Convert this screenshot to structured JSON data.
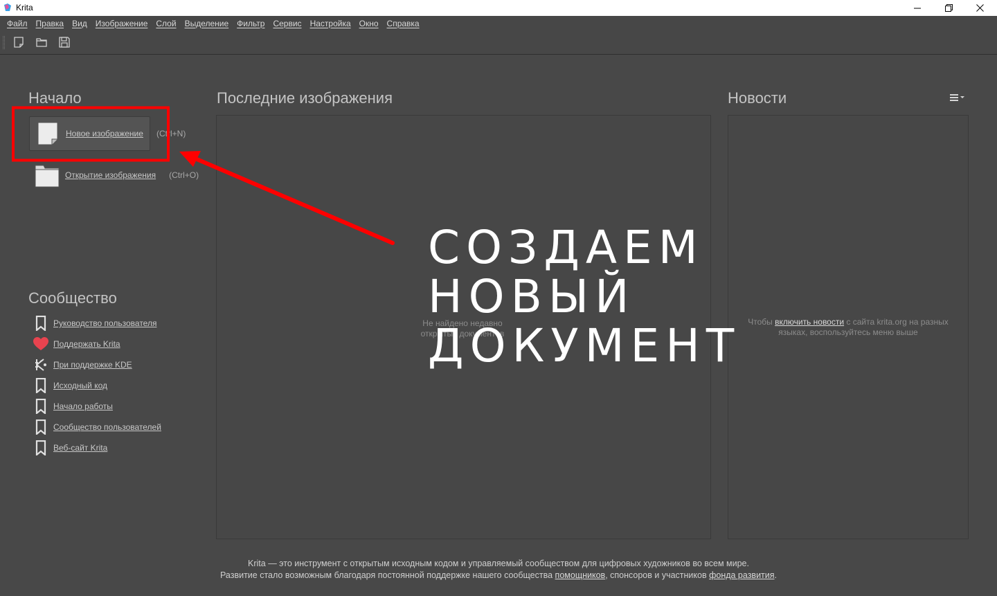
{
  "window": {
    "title": "Krita"
  },
  "menu": [
    "Файл",
    "Правка",
    "Вид",
    "Изображение",
    "Слой",
    "Выделение",
    "Фильтр",
    "Сервис",
    "Настройка",
    "Окно",
    "Справка"
  ],
  "start": {
    "heading": "Начало",
    "new_image": {
      "label": "Новое изображение",
      "shortcut": "(Ctrl+N)"
    },
    "open_image": {
      "label": "Открытие изображения",
      "shortcut": "(Ctrl+O)"
    }
  },
  "recent": {
    "heading": "Последние изображения",
    "empty_line1": "Не найдено недавно",
    "empty_line2": "открытых документов"
  },
  "news": {
    "heading": "Новости",
    "msg_before": "Чтобы ",
    "msg_link": "включить новости",
    "msg_after": " с сайта krita.org на разных",
    "msg_line2": "языках, воспользуйтесь меню выше"
  },
  "community": {
    "heading": "Сообщество",
    "items": [
      {
        "label": "Руководство пользователя",
        "icon": "bookmark-icon"
      },
      {
        "label": "Поддержать Krita",
        "icon": "heart-icon"
      },
      {
        "label": "При поддержке KDE",
        "icon": "kde-icon"
      },
      {
        "label": "Исходный код",
        "icon": "bookmark-icon"
      },
      {
        "label": "Начало работы",
        "icon": "bookmark-icon"
      },
      {
        "label": "Сообщество пользователей",
        "icon": "bookmark-icon"
      },
      {
        "label": "Веб-сайт Krita",
        "icon": "bookmark-icon"
      }
    ]
  },
  "footer": {
    "line1": "Krita — это инструмент с открытым исходным кодом и управляемый сообществом для цифровых художников во всем мире.",
    "line2_before": "Развитие стало возможным благодаря постоянной поддержке нашего сообщества ",
    "line2_link1": "помощников",
    "line2_middle": ", спонсоров и участников ",
    "line2_link2": "фонда развития",
    "line2_after": "."
  },
  "annotation": {
    "lines": [
      "СОЗДАЕМ",
      "НОВЫЙ",
      "ДОКУМЕНТ"
    ],
    "color": "#ff0000"
  }
}
